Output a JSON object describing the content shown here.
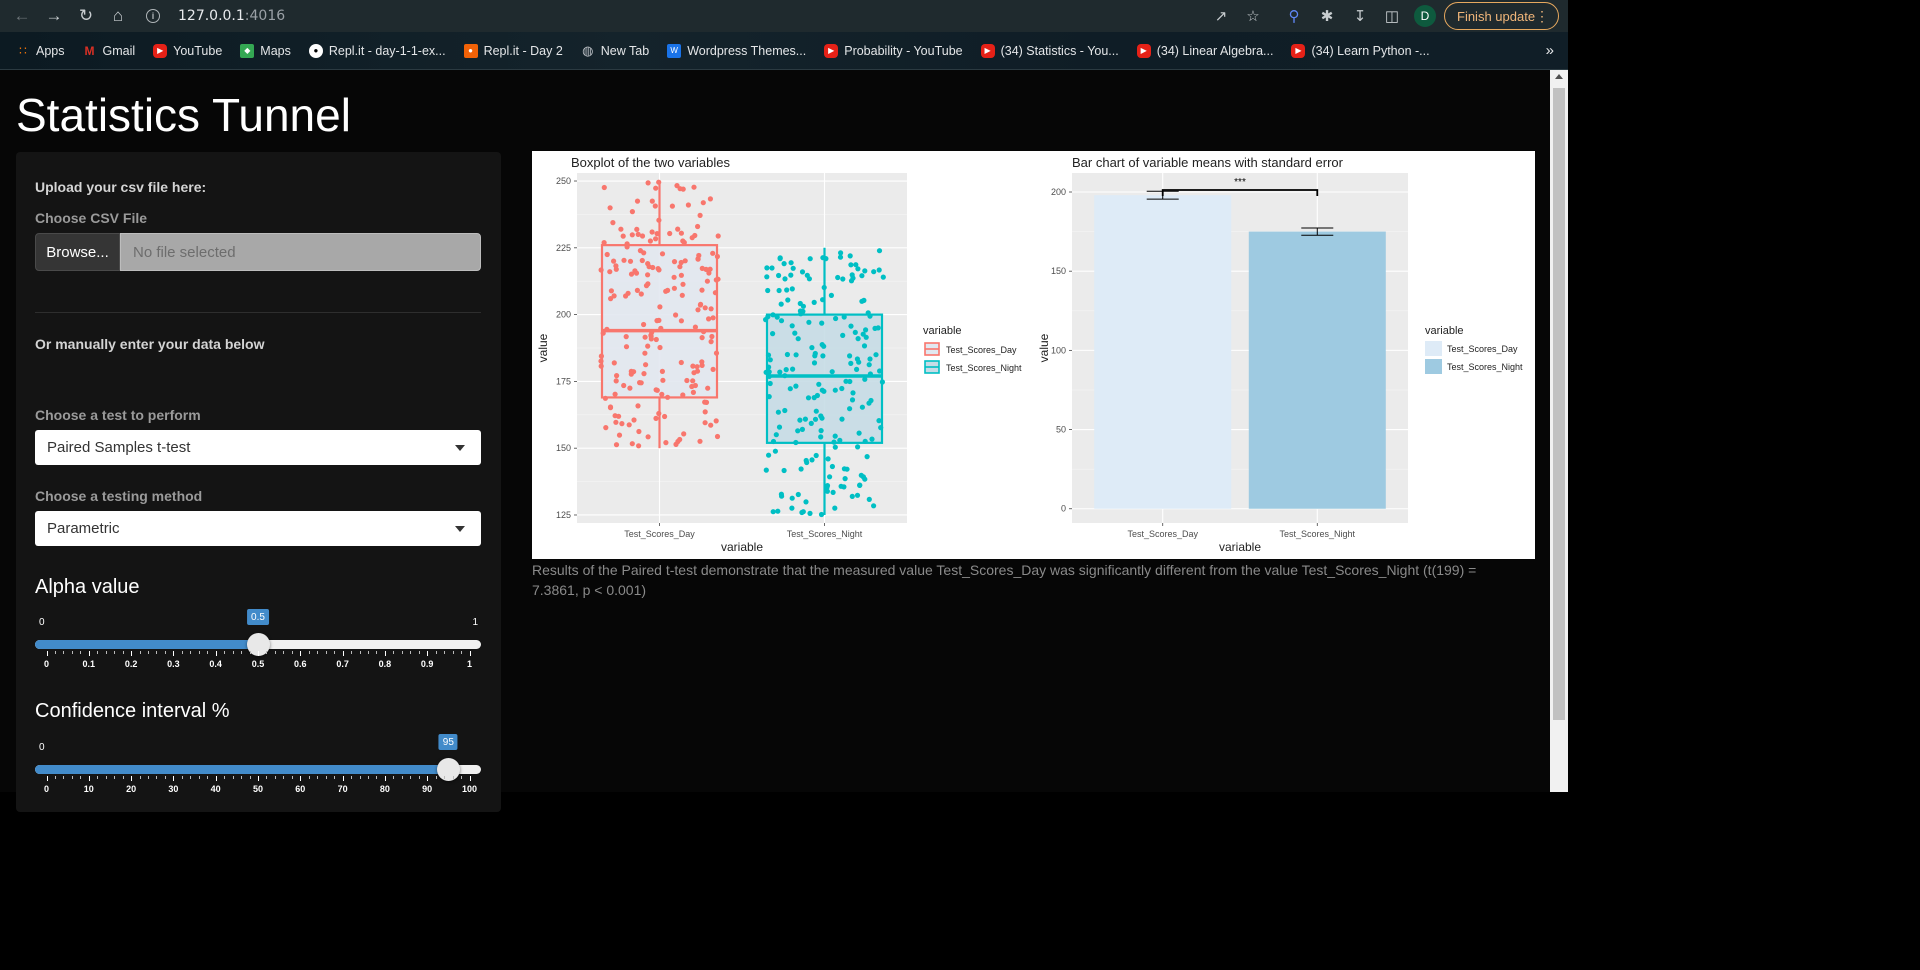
{
  "browser": {
    "url_host": "127.0.0.1",
    "url_port": ":4016",
    "finish_update_label": "Finish update",
    "profile_initial": "D"
  },
  "bookmarks": [
    {
      "label": "Apps",
      "icon": "apps-icon"
    },
    {
      "label": "Gmail",
      "icon": "gmail-icon"
    },
    {
      "label": "YouTube",
      "icon": "youtube-icon"
    },
    {
      "label": "Maps",
      "icon": "maps-icon"
    },
    {
      "label": "Repl.it - day-1-1-ex...",
      "icon": "replit-icon"
    },
    {
      "label": "Repl.it - Day 2",
      "icon": "replit-icon"
    },
    {
      "label": "New Tab",
      "icon": "globe-icon"
    },
    {
      "label": "Wordpress Themes...",
      "icon": "wordpress-icon"
    },
    {
      "label": "Probability - YouTube",
      "icon": "youtube-icon"
    },
    {
      "label": "(34) Statistics - You...",
      "icon": "youtube-icon"
    },
    {
      "label": "(34) Linear Algebra...",
      "icon": "youtube-icon"
    },
    {
      "label": "(34) Learn Python -...",
      "icon": "youtube-icon"
    }
  ],
  "app": {
    "title": "Statistics Tunnel"
  },
  "sidebar": {
    "upload_label": "Upload your csv file here:",
    "choose_csv_label": "Choose CSV File",
    "browse_label": "Browse...",
    "file_placeholder": "No file selected",
    "manual_label": "Or manually enter your data below",
    "test_label": "Choose a test to perform",
    "test_value": "Paired Samples t-test",
    "method_label": "Choose a testing method",
    "method_value": "Parametric",
    "alpha_title": "Alpha value",
    "alpha": {
      "min": "0",
      "max": "1",
      "value": "0.5",
      "fraction": 0.5,
      "tick_labels": [
        "0",
        "0.1",
        "0.2",
        "0.3",
        "0.4",
        "0.5",
        "0.6",
        "0.7",
        "0.8",
        "0.9",
        "1"
      ]
    },
    "ci_title": "Confidence interval %",
    "ci": {
      "min": "0",
      "value": "95",
      "fraction": 0.95,
      "tick_labels": [
        "0",
        "10",
        "20",
        "30",
        "40",
        "50",
        "60",
        "70",
        "80",
        "90",
        "100"
      ]
    }
  },
  "results": {
    "text": "Results of the Paired t-test demonstrate that the measured value Test_Scores_Day was significantly different from the value Test_Scores_Night (t(199) = 7.3861, p < 0.001)"
  },
  "colors": {
    "day": "#f8766d",
    "night": "#00bfc4",
    "bar_day": "#deebf7",
    "bar_night": "#9ecae1",
    "slider_accent": "#428bca"
  },
  "chart_data": [
    {
      "type": "boxplot",
      "title": "Boxplot of the two variables",
      "xlabel": "variable",
      "ylabel": "value",
      "categories": [
        "Test_Scores_Day",
        "Test_Scores_Night"
      ],
      "ylim": [
        122,
        253
      ],
      "yticks": [
        125,
        150,
        175,
        200,
        225,
        250
      ],
      "legend_title": "variable",
      "legend_entries": [
        "Test_Scores_Day",
        "Test_Scores_Night"
      ],
      "legend_placement": "right",
      "series": [
        {
          "name": "Test_Scores_Day",
          "min": 150,
          "q1": 169,
          "median": 194,
          "q3": 226,
          "max": 250,
          "n": 200
        },
        {
          "name": "Test_Scores_Night",
          "min": 125,
          "q1": 152,
          "median": 177,
          "q3": 200,
          "max": 225,
          "n": 200
        }
      ]
    },
    {
      "type": "bar",
      "title": "Bar chart of variable means with standard error",
      "xlabel": "variable",
      "ylabel": "value",
      "categories": [
        "Test_Scores_Day",
        "Test_Scores_Night"
      ],
      "values": [
        198,
        175
      ],
      "errors": [
        2.5,
        2.3
      ],
      "ylim": [
        -9,
        212
      ],
      "yticks": [
        0,
        50,
        100,
        150,
        200
      ],
      "significance": "***",
      "legend_title": "variable",
      "legend_entries": [
        "Test_Scores_Day",
        "Test_Scores_Night"
      ],
      "legend_placement": "right"
    }
  ]
}
